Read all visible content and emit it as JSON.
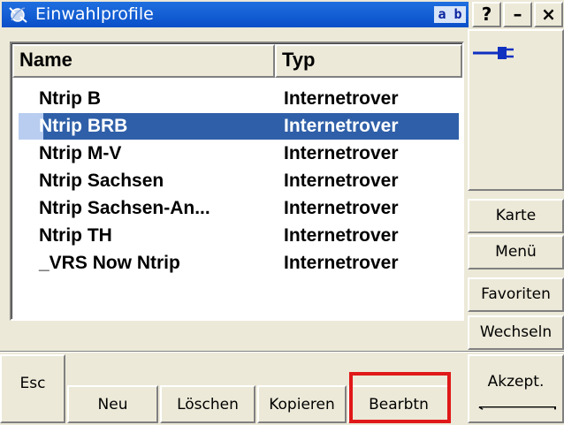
{
  "window": {
    "title": "Einwahlprofile",
    "input_mode": "a b",
    "help_label": "?",
    "minimize_label": "–",
    "close_label": "×"
  },
  "list": {
    "columns": [
      "Name",
      "Typ"
    ],
    "rows": [
      {
        "name": "Ntrip B",
        "type": "Internetrover",
        "selected": false
      },
      {
        "name": "Ntrip BRB",
        "type": "Internetrover",
        "selected": true
      },
      {
        "name": "Ntrip M-V",
        "type": "Internetrover",
        "selected": false
      },
      {
        "name": "Ntrip Sachsen",
        "type": "Internetrover",
        "selected": false
      },
      {
        "name": "Ntrip Sachsen-An...",
        "type": "Internetrover",
        "selected": false
      },
      {
        "name": "Ntrip TH",
        "type": "Internetrover",
        "selected": false
      },
      {
        "name": "_VRS Now Ntrip",
        "type": "Internetrover",
        "selected": false
      }
    ]
  },
  "side_menu": [
    "Karte",
    "Menü",
    "Favoriten",
    "Wechseln"
  ],
  "bottom_buttons": {
    "esc": "Esc",
    "new": "Neu",
    "delete": "Löschen",
    "copy": "Kopieren",
    "edit": "Bearbtn",
    "accept": "Akzept."
  },
  "colors": {
    "title_bar": "#0a4fc8",
    "selection": "#2f5fa8",
    "highlight": "#e01818",
    "plug_icon": "#1030c0"
  },
  "icons": {
    "app": "satellite-icon",
    "connection": "plug-icon"
  }
}
